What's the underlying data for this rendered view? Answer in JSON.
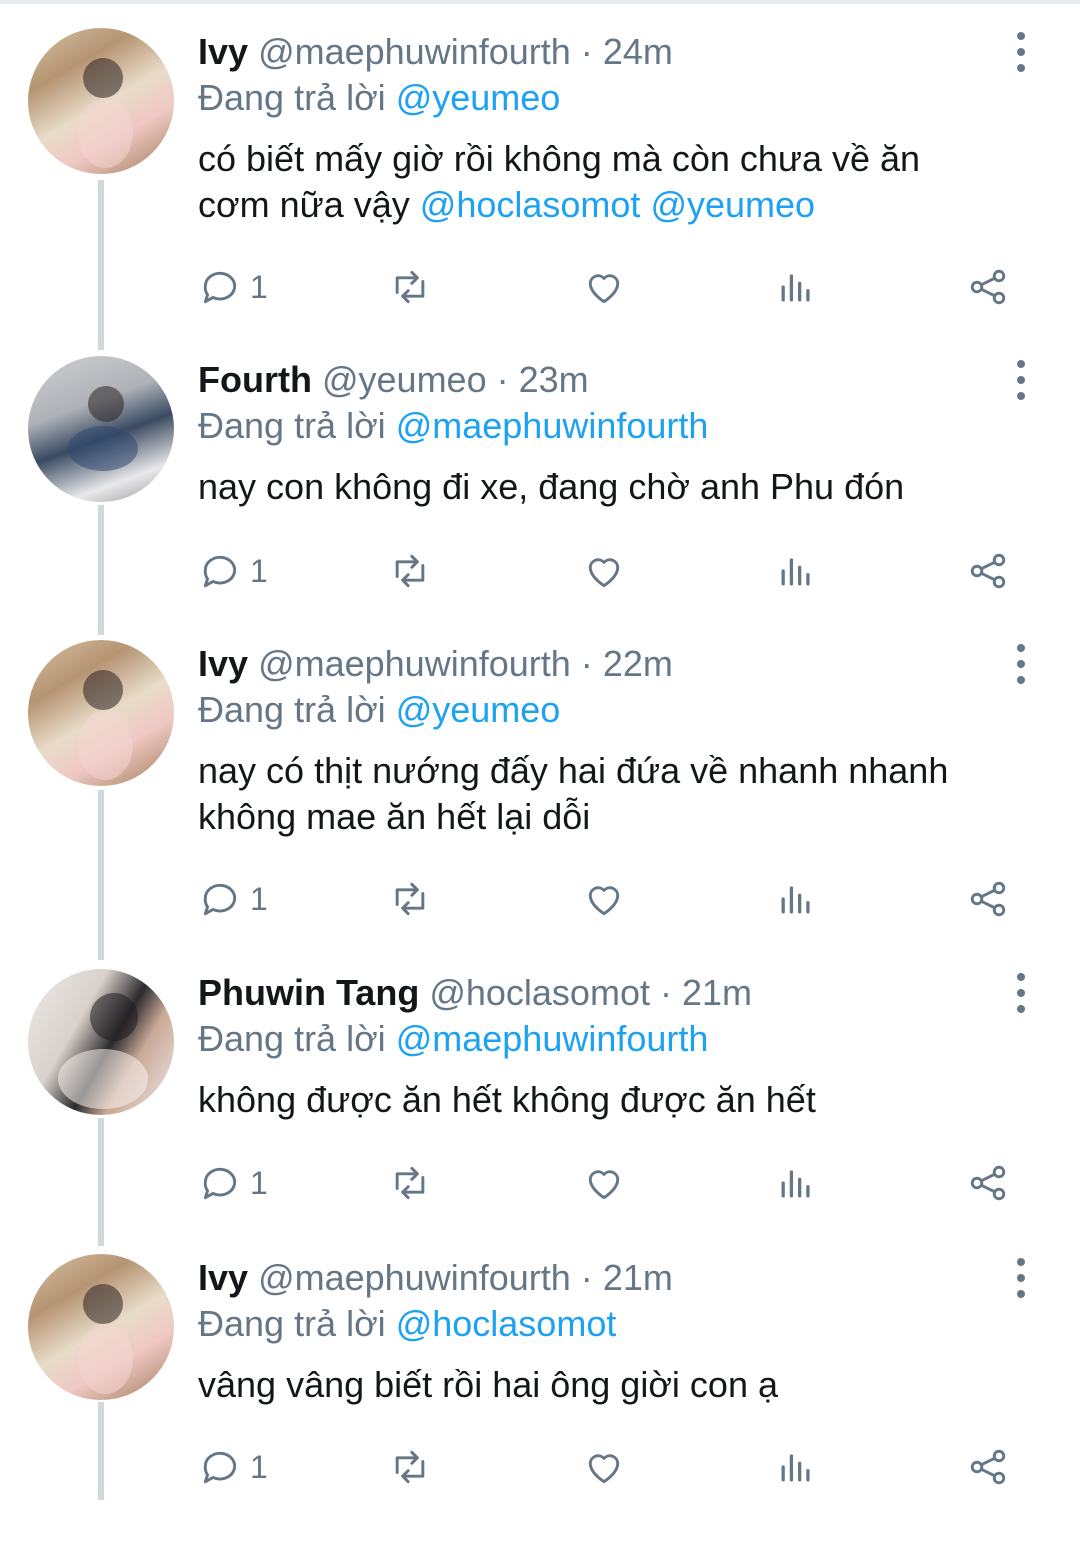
{
  "reply_prefix": "Đang trả lời",
  "icons": {
    "reply": "comment-bubble-icon",
    "retweet": "retweet-icon",
    "like": "heart-icon",
    "analytics": "bar-chart-icon",
    "share": "share-icon",
    "more": "vertical-dots-icon"
  },
  "colors": {
    "link": "#1da1f2",
    "muted": "#657786",
    "thread": "#cfd9de"
  },
  "tweets": [
    {
      "name": "Ivy",
      "handle": "@maephuwinfourth",
      "separator": "·",
      "time": "24m",
      "reply_to": "@yeumeo",
      "text": "có biết mấy giờ rồi không mà còn chưa về ăn",
      "text_line2": "cơm nữa vậy",
      "mentions": [
        "@hoclasomot",
        "@yeumeo"
      ],
      "reply_count": "1"
    },
    {
      "name": "Fourth",
      "handle": "@yeumeo",
      "separator": "·",
      "time": "23m",
      "reply_to": "@maephuwinfourth",
      "text": "nay con không đi xe, đang chờ anh Phu đón",
      "reply_count": "1"
    },
    {
      "name": "Ivy",
      "handle": "@maephuwinfourth",
      "separator": "·",
      "time": "22m",
      "reply_to": "@yeumeo",
      "text": "nay có thịt nướng đấy hai đứa về nhanh nhanh",
      "text_line2": "không mae ăn hết lại dỗi",
      "reply_count": "1"
    },
    {
      "name": "Phuwin Tang",
      "handle": "@hoclasomot",
      "separator": "·",
      "time": "21m",
      "reply_to": "@maephuwinfourth",
      "text": "không được ăn hết không được ăn hết",
      "reply_count": "1"
    },
    {
      "name": "Ivy",
      "handle": "@maephuwinfourth",
      "separator": "·",
      "time": "21m",
      "reply_to": "@hoclasomot",
      "text": "vâng vâng biết rồi hai ông giời con ạ",
      "reply_count": "1"
    }
  ]
}
